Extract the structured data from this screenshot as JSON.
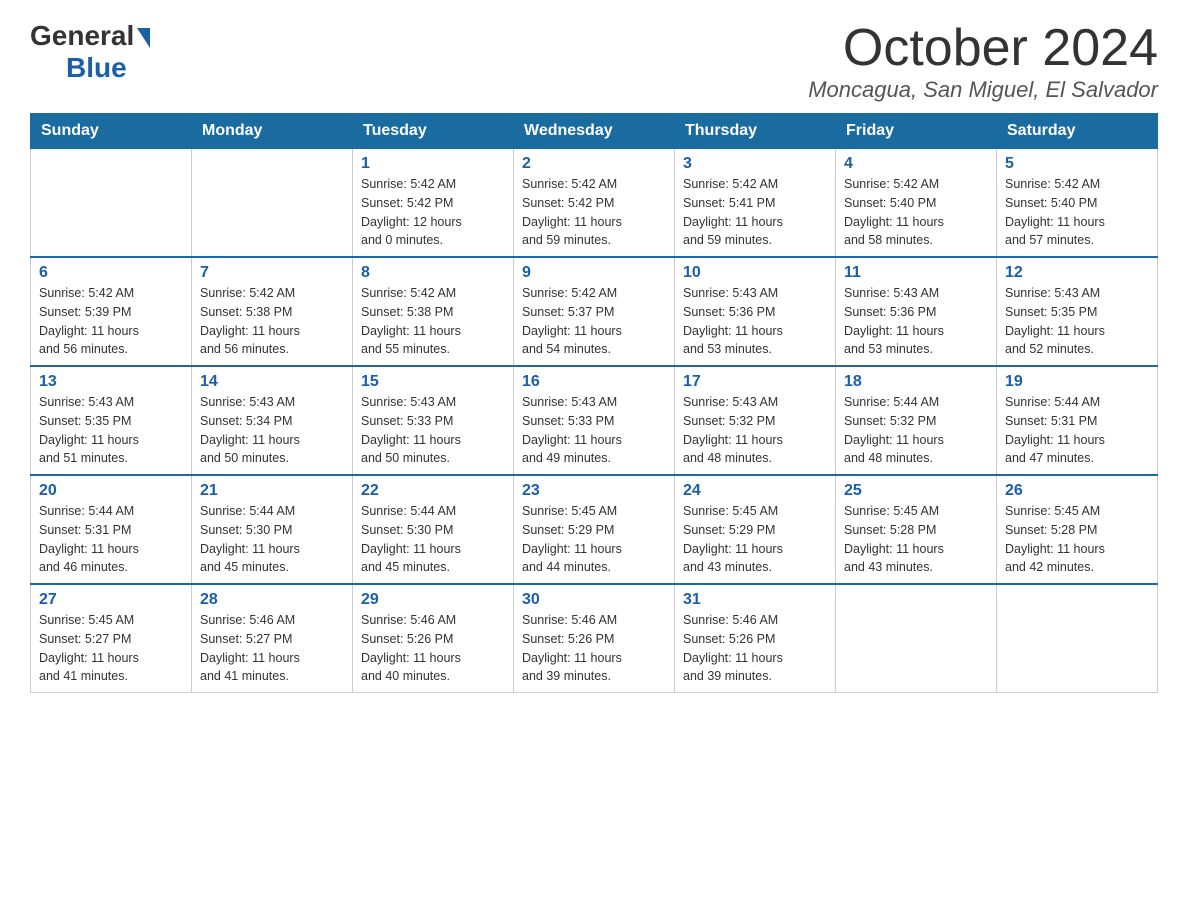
{
  "header": {
    "logo": {
      "general": "General",
      "blue": "Blue",
      "arrow": "▶"
    },
    "month_title": "October 2024",
    "location": "Moncagua, San Miguel, El Salvador"
  },
  "days_of_week": [
    "Sunday",
    "Monday",
    "Tuesday",
    "Wednesday",
    "Thursday",
    "Friday",
    "Saturday"
  ],
  "weeks": [
    [
      {
        "day": "",
        "info": ""
      },
      {
        "day": "",
        "info": ""
      },
      {
        "day": "1",
        "info": "Sunrise: 5:42 AM\nSunset: 5:42 PM\nDaylight: 12 hours\nand 0 minutes."
      },
      {
        "day": "2",
        "info": "Sunrise: 5:42 AM\nSunset: 5:42 PM\nDaylight: 11 hours\nand 59 minutes."
      },
      {
        "day": "3",
        "info": "Sunrise: 5:42 AM\nSunset: 5:41 PM\nDaylight: 11 hours\nand 59 minutes."
      },
      {
        "day": "4",
        "info": "Sunrise: 5:42 AM\nSunset: 5:40 PM\nDaylight: 11 hours\nand 58 minutes."
      },
      {
        "day": "5",
        "info": "Sunrise: 5:42 AM\nSunset: 5:40 PM\nDaylight: 11 hours\nand 57 minutes."
      }
    ],
    [
      {
        "day": "6",
        "info": "Sunrise: 5:42 AM\nSunset: 5:39 PM\nDaylight: 11 hours\nand 56 minutes."
      },
      {
        "day": "7",
        "info": "Sunrise: 5:42 AM\nSunset: 5:38 PM\nDaylight: 11 hours\nand 56 minutes."
      },
      {
        "day": "8",
        "info": "Sunrise: 5:42 AM\nSunset: 5:38 PM\nDaylight: 11 hours\nand 55 minutes."
      },
      {
        "day": "9",
        "info": "Sunrise: 5:42 AM\nSunset: 5:37 PM\nDaylight: 11 hours\nand 54 minutes."
      },
      {
        "day": "10",
        "info": "Sunrise: 5:43 AM\nSunset: 5:36 PM\nDaylight: 11 hours\nand 53 minutes."
      },
      {
        "day": "11",
        "info": "Sunrise: 5:43 AM\nSunset: 5:36 PM\nDaylight: 11 hours\nand 53 minutes."
      },
      {
        "day": "12",
        "info": "Sunrise: 5:43 AM\nSunset: 5:35 PM\nDaylight: 11 hours\nand 52 minutes."
      }
    ],
    [
      {
        "day": "13",
        "info": "Sunrise: 5:43 AM\nSunset: 5:35 PM\nDaylight: 11 hours\nand 51 minutes."
      },
      {
        "day": "14",
        "info": "Sunrise: 5:43 AM\nSunset: 5:34 PM\nDaylight: 11 hours\nand 50 minutes."
      },
      {
        "day": "15",
        "info": "Sunrise: 5:43 AM\nSunset: 5:33 PM\nDaylight: 11 hours\nand 50 minutes."
      },
      {
        "day": "16",
        "info": "Sunrise: 5:43 AM\nSunset: 5:33 PM\nDaylight: 11 hours\nand 49 minutes."
      },
      {
        "day": "17",
        "info": "Sunrise: 5:43 AM\nSunset: 5:32 PM\nDaylight: 11 hours\nand 48 minutes."
      },
      {
        "day": "18",
        "info": "Sunrise: 5:44 AM\nSunset: 5:32 PM\nDaylight: 11 hours\nand 48 minutes."
      },
      {
        "day": "19",
        "info": "Sunrise: 5:44 AM\nSunset: 5:31 PM\nDaylight: 11 hours\nand 47 minutes."
      }
    ],
    [
      {
        "day": "20",
        "info": "Sunrise: 5:44 AM\nSunset: 5:31 PM\nDaylight: 11 hours\nand 46 minutes."
      },
      {
        "day": "21",
        "info": "Sunrise: 5:44 AM\nSunset: 5:30 PM\nDaylight: 11 hours\nand 45 minutes."
      },
      {
        "day": "22",
        "info": "Sunrise: 5:44 AM\nSunset: 5:30 PM\nDaylight: 11 hours\nand 45 minutes."
      },
      {
        "day": "23",
        "info": "Sunrise: 5:45 AM\nSunset: 5:29 PM\nDaylight: 11 hours\nand 44 minutes."
      },
      {
        "day": "24",
        "info": "Sunrise: 5:45 AM\nSunset: 5:29 PM\nDaylight: 11 hours\nand 43 minutes."
      },
      {
        "day": "25",
        "info": "Sunrise: 5:45 AM\nSunset: 5:28 PM\nDaylight: 11 hours\nand 43 minutes."
      },
      {
        "day": "26",
        "info": "Sunrise: 5:45 AM\nSunset: 5:28 PM\nDaylight: 11 hours\nand 42 minutes."
      }
    ],
    [
      {
        "day": "27",
        "info": "Sunrise: 5:45 AM\nSunset: 5:27 PM\nDaylight: 11 hours\nand 41 minutes."
      },
      {
        "day": "28",
        "info": "Sunrise: 5:46 AM\nSunset: 5:27 PM\nDaylight: 11 hours\nand 41 minutes."
      },
      {
        "day": "29",
        "info": "Sunrise: 5:46 AM\nSunset: 5:26 PM\nDaylight: 11 hours\nand 40 minutes."
      },
      {
        "day": "30",
        "info": "Sunrise: 5:46 AM\nSunset: 5:26 PM\nDaylight: 11 hours\nand 39 minutes."
      },
      {
        "day": "31",
        "info": "Sunrise: 5:46 AM\nSunset: 5:26 PM\nDaylight: 11 hours\nand 39 minutes."
      },
      {
        "day": "",
        "info": ""
      },
      {
        "day": "",
        "info": ""
      }
    ]
  ]
}
